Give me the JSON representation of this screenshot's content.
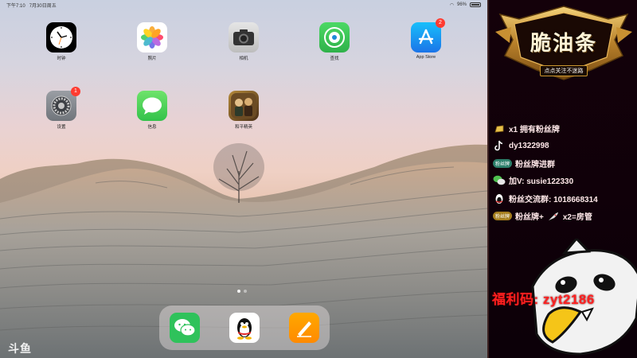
{
  "status_bar": {
    "time": "下午7:10",
    "date": "7月30日周五",
    "battery": "96%"
  },
  "apps": [
    {
      "id": "clock",
      "label": "时钟",
      "icon": "clock-icon",
      "badge": null
    },
    {
      "id": "photos",
      "label": "照片",
      "icon": "photos-icon",
      "badge": null
    },
    {
      "id": "camera",
      "label": "相机",
      "icon": "camera-icon",
      "badge": null
    },
    {
      "id": "findmy",
      "label": "查找",
      "icon": "find-my-icon",
      "badge": null
    },
    {
      "id": "appstore",
      "label": "App Store",
      "icon": "app-store-icon",
      "badge": "2"
    },
    {
      "id": "settings",
      "label": "设置",
      "icon": "settings-gear-icon",
      "badge": "1"
    },
    {
      "id": "messages",
      "label": "信息",
      "icon": "messages-icon",
      "badge": null
    },
    {
      "id": "game",
      "label": "和平精英",
      "icon": "game-icon",
      "badge": null
    }
  ],
  "dock": [
    {
      "id": "wechat",
      "icon": "wechat-icon"
    },
    {
      "id": "qq",
      "icon": "qq-penguin-icon"
    },
    {
      "id": "pages",
      "icon": "pages-icon"
    }
  ],
  "watermark": "斗鱼",
  "overlay": {
    "logo_title": "脆油条",
    "logo_subtitle": "点点关注不迷路",
    "rows": [
      {
        "id": "fan-badge",
        "text": "x1 拥有粉丝牌"
      },
      {
        "id": "douyin",
        "text": "dy1322998"
      },
      {
        "id": "fan-group",
        "pill": "粉丝牌",
        "text": "粉丝牌进群"
      },
      {
        "id": "wechat-add",
        "text": "加V: susie122330"
      },
      {
        "id": "qq-group",
        "text": "粉丝交流群: 1018668314"
      },
      {
        "id": "room-admin",
        "pill": "粉丝牌",
        "text": "粉丝牌+",
        "suffix": "x2=房管"
      }
    ],
    "promo_label": "福利码:",
    "promo_code": "zyt2186"
  },
  "colors": {
    "promo": "#ff2020",
    "overlay_bg": "#14010a",
    "badge": "#ff3b30"
  }
}
